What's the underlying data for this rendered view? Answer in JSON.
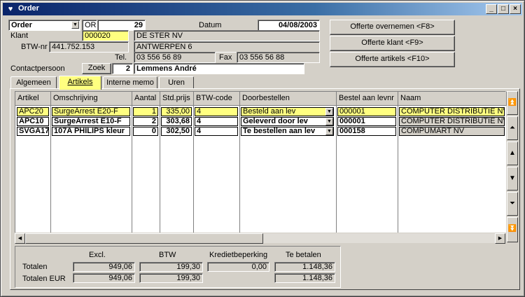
{
  "window": {
    "title": "Order",
    "controls": [
      "_",
      "□",
      "×"
    ]
  },
  "header": {
    "doc_type": "Order",
    "doc_prefix": "OR",
    "doc_number": "29",
    "datum_label": "Datum",
    "datum_value": "04/08/2003",
    "klant_label": "Klant",
    "klant_code": "000020",
    "klant_name": "DE STER NV",
    "klant_city": "ANTWERPEN 6",
    "btw_label": "BTW-nr",
    "btw_value": "441.752.153",
    "tel_label": "Tel.",
    "tel_value": "03 556 56 89",
    "fax_label": "Fax",
    "fax_value": "03 556 56 88",
    "contact_label": "Contactpersoon",
    "zoek_label": "Zoek",
    "contact_nr": "2",
    "contact_name": "Lemmens André"
  },
  "actions": {
    "offerte_overnemen": "Offerte overnemen <F8>",
    "offerte_klant": "Offerte klant <F9>",
    "offerte_artikels": "Offerte artikels <F10>"
  },
  "tabs": [
    "Algemeen",
    "Artikels",
    "Interne memo",
    "Uren"
  ],
  "table": {
    "columns": [
      "Artikel",
      "Omschrijving",
      "Aantal",
      "Std.prijs",
      "BTW-code",
      "Doorbestellen",
      "Bestel aan levnr",
      "Naam"
    ],
    "rows": [
      {
        "artikel": "APC20",
        "omschrijving": "SurgeArrest E20-F",
        "aantal": "1",
        "prijs": "335,00",
        "btw": "4",
        "door": "Besteld aan lev",
        "levnr": "000001",
        "naam": "COMPUTER DISTRIBUTIE NV"
      },
      {
        "artikel": "APC10",
        "omschrijving": "SurgeArrest E10-F",
        "aantal": "2",
        "prijs": "303,68",
        "btw": "4",
        "door": "Geleverd door lev",
        "levnr": "000001",
        "naam": "COMPUTER DISTRIBUTIE NV"
      },
      {
        "artikel": "SVGA17",
        "omschrijving": "107A PHILIPS kleur",
        "aantal": "0",
        "prijs": "302,50",
        "btw": "4",
        "door": "Te bestellen aan lev",
        "levnr": "000158",
        "naam": "COMPUMART NV"
      }
    ]
  },
  "totals": {
    "headers": [
      "Excl.",
      "BTW",
      "Kredietbeperking",
      "Te betalen"
    ],
    "totalen_label": "Totalen",
    "totalen_eur_label": "Totalen EUR",
    "totalen": [
      "949,06",
      "199,30",
      "0,00",
      "1.148,36"
    ],
    "totalen_eur": [
      "949,06",
      "199,30",
      "1.148,36"
    ]
  },
  "colors": {
    "titlebar": "#0a246a",
    "highlight": "#ffff80",
    "face": "#d4d0c8"
  }
}
